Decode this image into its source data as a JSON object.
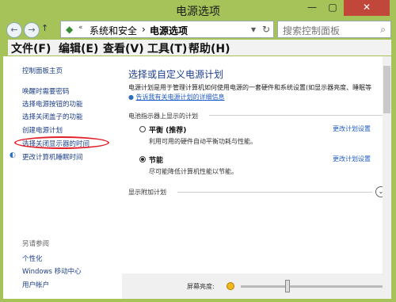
{
  "window": {
    "title": "电源选项"
  },
  "address": {
    "crumb1": "系统和安全",
    "sep": "›",
    "crumb2": "电源选项",
    "search_placeholder": "搜索控制面板"
  },
  "menu": {
    "items": [
      "文件(F)",
      "编辑(E)",
      "查看(V)",
      "工具(T)",
      "帮助(H)"
    ]
  },
  "sidebar": {
    "home": "控制面板主页",
    "links": [
      "唤醒时需要密码",
      "选择电源按钮的功能",
      "选择关闭盖子的功能",
      "创建电源计划",
      "选择关闭显示器的时间",
      "更改计算机睡眠时间"
    ],
    "see_also_header": "另请参阅",
    "see_also": [
      "个性化",
      "Windows 移动中心",
      "用户帐户"
    ]
  },
  "main": {
    "heading": "选择或自定义电源计划",
    "description": "电源计划是用于管理计算机如何使用电源的一套硬件和系统设置(如显示器亮度、睡眠等",
    "help_link": "告诉我有关电源计划的详细信息",
    "section_label": "电池指示器上显示的计划",
    "plans": [
      {
        "name": "平衡 (推荐)",
        "desc": "利用可用的硬件自动平衡功耗与性能。",
        "selected": false,
        "change": "更改计划设置"
      },
      {
        "name": "节能",
        "desc": "尽可能降低计算机性能以节能。",
        "selected": true,
        "change": "更改计划设置"
      }
    ],
    "more_plans": "显示附加计划",
    "brightness_label": "屏幕亮度:"
  }
}
